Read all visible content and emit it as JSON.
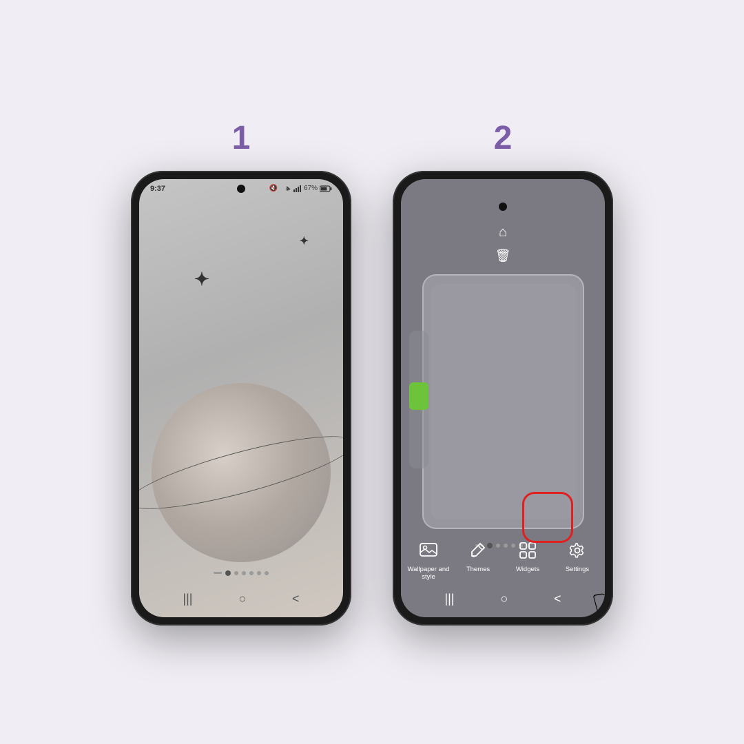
{
  "background_color": "#f0eef4",
  "step1": {
    "number": "1",
    "phone": {
      "time": "9:37",
      "battery": "67%",
      "status_icons": "🔇 📶 67%"
    }
  },
  "step2": {
    "number": "2",
    "bottom_bar": {
      "wallpaper_label": "Wallpaper and style",
      "themes_label": "Themes",
      "widgets_label": "Widgets",
      "settings_label": "Settings"
    }
  }
}
